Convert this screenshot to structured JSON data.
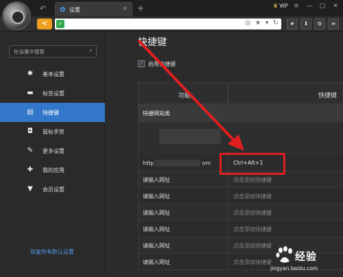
{
  "browser": {
    "tab_title": "设置",
    "tab_close": "×",
    "new_tab": "+",
    "vip_label": "VIP",
    "nav_back": "<",
    "secure": "✓"
  },
  "sidebar": {
    "search_placeholder": "在设置中搜索",
    "items": [
      {
        "label": "基本设置",
        "icon": "gear-icon"
      },
      {
        "label": "标签设置",
        "icon": "tab-icon"
      },
      {
        "label": "快捷键",
        "icon": "keyboard-icon",
        "active": true
      },
      {
        "label": "鼠标手势",
        "icon": "mouse-icon"
      },
      {
        "label": "更多设置",
        "icon": "wrench-icon"
      },
      {
        "label": "我的应用",
        "icon": "puzzle-icon"
      },
      {
        "label": "会员设置",
        "icon": "vip-icon"
      }
    ],
    "restore_link": "恢复所有默认设置"
  },
  "main": {
    "title": "快捷键",
    "enable_label": "启用快捷键",
    "table": {
      "col1_header": "功能",
      "col2_header": "快捷键",
      "section_label": "快捷网站类",
      "first_row": {
        "site_prefix": "http",
        "site_suffix": "om",
        "shortcut": "Ctrl+Alt+1"
      },
      "rows": [
        {
          "site": "请输入网址",
          "shortcut": "点击添加快捷键"
        },
        {
          "site": "请输入网址",
          "shortcut": "点击添加快捷键"
        },
        {
          "site": "请输入网址",
          "shortcut": "点击添加快捷键"
        },
        {
          "site": "请输入网址",
          "shortcut": "点击添加快捷键"
        },
        {
          "site": "请输入网址",
          "shortcut": "点击添加快捷键"
        },
        {
          "site": "请输入网址",
          "shortcut": "点击添加快捷键"
        }
      ]
    }
  },
  "watermark": {
    "brand": "经验",
    "url": "jingyan.baidu.com"
  },
  "colors": {
    "accent": "#3277c9",
    "highlight": "#e02020",
    "nav_back": "#f0a020"
  }
}
